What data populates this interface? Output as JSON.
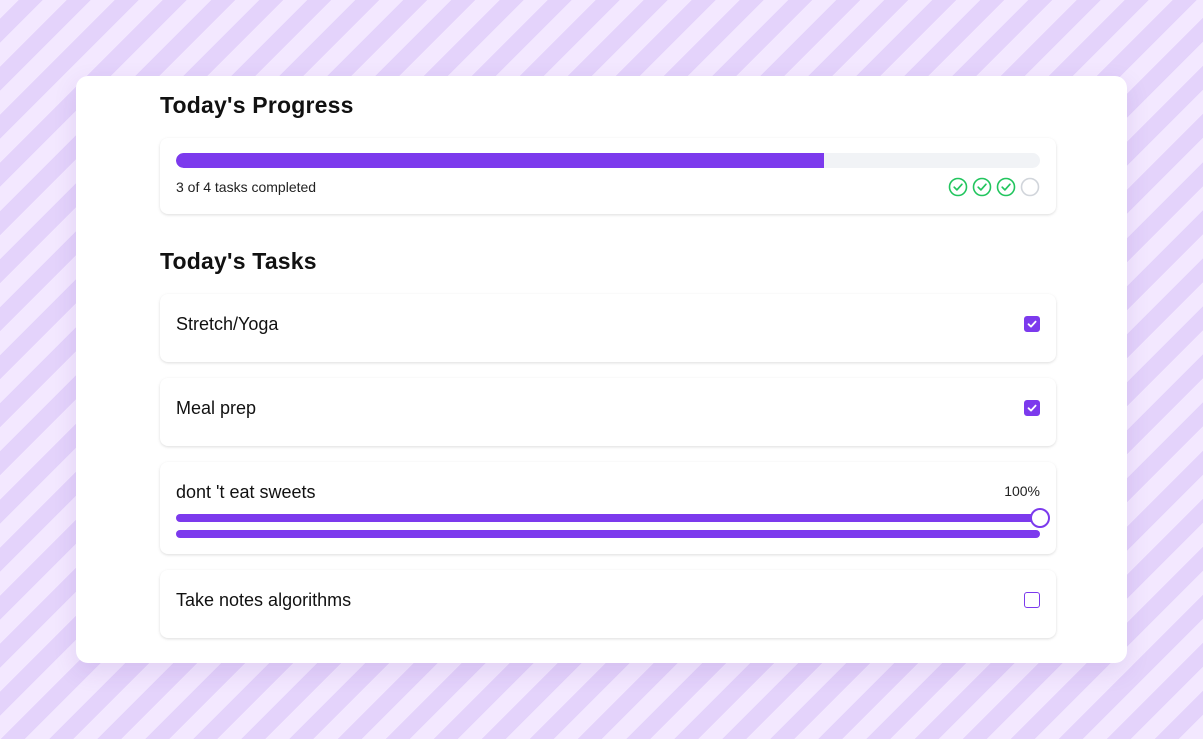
{
  "progress": {
    "title": "Today's Progress",
    "completed_fraction": 0.75,
    "summary_text": "3 of 4 tasks completed",
    "status_icons": [
      "check-circle-icon",
      "check-circle-icon",
      "check-circle-icon",
      "empty-circle-icon"
    ]
  },
  "tasks": {
    "title": "Today's Tasks",
    "items": [
      {
        "label": "Stretch/Yoga",
        "type": "checkbox",
        "checked": true
      },
      {
        "label": "Meal prep",
        "type": "checkbox",
        "checked": true
      },
      {
        "label": "dont 't eat sweets",
        "type": "slider",
        "percent_text": "100%",
        "value": 1.0
      },
      {
        "label": "Take notes algorithms",
        "type": "checkbox",
        "checked": false
      }
    ]
  },
  "colors": {
    "accent": "#7c3aed",
    "success": "#22c55e",
    "empty_circle": "#d1d5db",
    "track": "#f1f3f6"
  }
}
